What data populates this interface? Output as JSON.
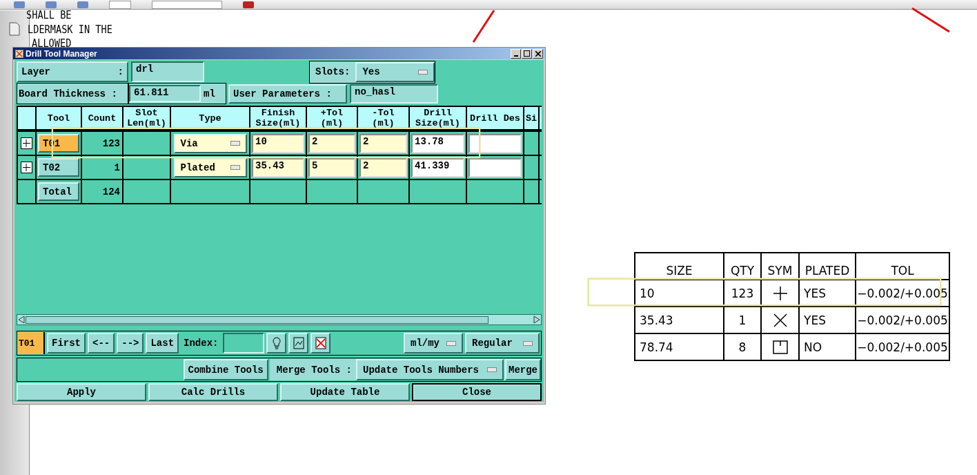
{
  "background_text": [
    "SHALL BE",
    "LDERMASK IN THE",
    "ALLOWED"
  ],
  "dialog": {
    "title": "Drill Tool Manager",
    "layer": {
      "label": "Layer",
      "colon": ":",
      "value": "drl"
    },
    "slots": {
      "label": "Slots:",
      "value": "Yes"
    },
    "board_thickness": {
      "label": "Board Thickness :",
      "value": "61.811",
      "unit": "ml"
    },
    "user_parameters": {
      "label": "User Parameters :",
      "value": "no_hasl"
    },
    "table": {
      "columns": [
        "Tool",
        "Count",
        "Slot Len(ml)",
        "Type",
        "Finish Size(ml)",
        "+Tol (ml)",
        "-Tol (ml)",
        "Drill Size(ml)",
        "Drill Des",
        "Si"
      ],
      "rows": [
        {
          "kind": "tool",
          "tool": "T01",
          "selected": true,
          "count": "123",
          "type": "Via",
          "finish": "10",
          "plus_tol": "2",
          "minus_tol": "2",
          "drill_size": "13.78"
        },
        {
          "kind": "tool",
          "tool": "T02",
          "selected": false,
          "count": "1",
          "type": "Plated",
          "finish": "35.43",
          "plus_tol": "5",
          "minus_tol": "2",
          "drill_size": "41.339"
        },
        {
          "kind": "total",
          "tool": "Total",
          "count": "124"
        }
      ]
    },
    "current_tool": "T01",
    "nav_buttons": [
      "First",
      "<--",
      "-->",
      "Last"
    ],
    "index_label": "Index:",
    "units": "ml/my",
    "mode": "Regular",
    "combine_button": "Combine Tools",
    "merge_label": "Merge Tools :",
    "merge_option": "Update Tools Numbers",
    "merge_button": "Merge",
    "actions": [
      {
        "label": "Apply",
        "default": false
      },
      {
        "label": "Calc Drills",
        "default": false
      },
      {
        "label": "Update Table",
        "default": false
      },
      {
        "label": "Close",
        "default": true
      }
    ]
  },
  "drill_chart": {
    "columns": [
      "SIZE",
      "QTY",
      "SYM",
      "PLATED",
      "TOL"
    ],
    "rows": [
      {
        "size": "10",
        "qty": "123",
        "kind": "plus",
        "plated": "YES",
        "tol": "−0.002/+0.005"
      },
      {
        "size": "35.43",
        "qty": "1",
        "kind": "cross",
        "plated": "YES",
        "tol": "−0.002/+0.005"
      },
      {
        "size": "78.74",
        "qty": "8",
        "kind": "square",
        "plated": "NO",
        "tol": "−0.002/+0.005"
      }
    ]
  }
}
